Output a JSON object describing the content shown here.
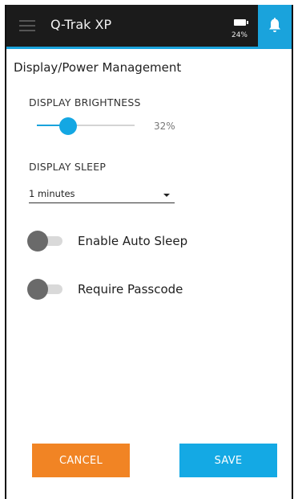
{
  "header": {
    "app_title": "Q-Trak XP",
    "battery_percent": "24%",
    "menu_icon": "hamburger-menu-icon",
    "notifications_icon": "bell-icon"
  },
  "page": {
    "title": "Display/Power Management"
  },
  "brightness": {
    "label": "DISPLAY BRIGHTNESS",
    "value": 32,
    "value_text": "32%"
  },
  "sleep": {
    "label": "DISPLAY SLEEP",
    "selected": "1 minutes"
  },
  "toggles": {
    "auto_sleep": {
      "label": "Enable Auto Sleep",
      "on": false
    },
    "passcode": {
      "label": "Require Passcode",
      "on": false
    }
  },
  "actions": {
    "cancel": "CANCEL",
    "save": "SAVE"
  },
  "colors": {
    "accent": "#1aa3dc",
    "cancel": "#f18424",
    "header_bg": "#1b1b1b"
  }
}
